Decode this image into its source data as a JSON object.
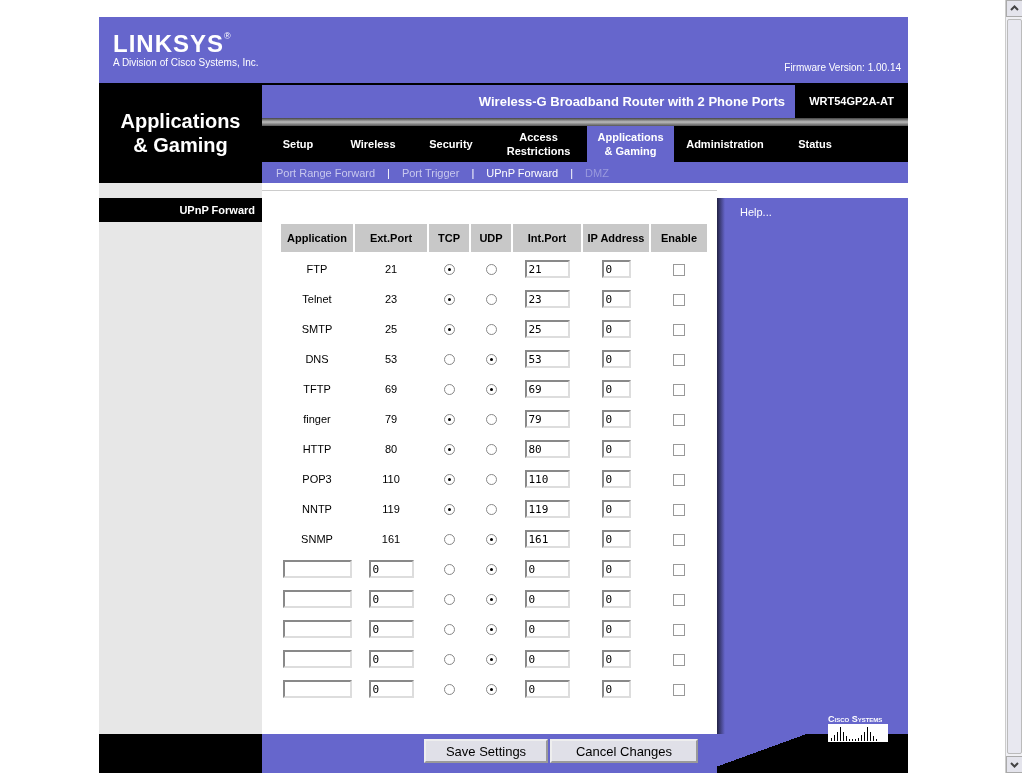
{
  "header": {
    "logo": "LINKSYS",
    "logo_mark": "®",
    "tagline": "A Division of Cisco Systems, Inc.",
    "firmware": "Firmware Version: 1.00.14"
  },
  "section_title": "Applications & Gaming",
  "product": {
    "name": "Wireless-G Broadband Router with 2 Phone Ports",
    "model": "WRT54GP2A-AT"
  },
  "tabs": [
    {
      "label": "Setup",
      "selected": false
    },
    {
      "label": "Wireless",
      "selected": false
    },
    {
      "label": "Security",
      "selected": false
    },
    {
      "label": "Access Restrictions",
      "selected": false
    },
    {
      "label": "Applications & Gaming",
      "selected": true
    },
    {
      "label": "Administration",
      "selected": false
    },
    {
      "label": "Status",
      "selected": false
    }
  ],
  "subtabs": [
    {
      "label": "Port Range Forward",
      "selected": false,
      "disabled": false
    },
    {
      "separator": "|",
      "label": "Port Trigger",
      "selected": false,
      "disabled": false
    },
    {
      "separator": "|",
      "label": "UPnP Forward",
      "selected": true,
      "disabled": false
    },
    {
      "separator": "|",
      "label": "DMZ",
      "selected": false,
      "disabled": true
    }
  ],
  "sidebar_title": "UPnP Forward",
  "help": "Help...",
  "table": {
    "columns": [
      "Application",
      "Ext.Port",
      "TCP",
      "UDP",
      "Int.Port",
      "IP Address",
      "Enable"
    ],
    "rows": [
      {
        "kind": "fixed",
        "application": "FTP",
        "ext_port": "21",
        "tcp": true,
        "udp": false,
        "int_port": "21",
        "ip": "0",
        "enabled": false
      },
      {
        "kind": "fixed",
        "application": "Telnet",
        "ext_port": "23",
        "tcp": true,
        "udp": false,
        "int_port": "23",
        "ip": "0",
        "enabled": false
      },
      {
        "kind": "fixed",
        "application": "SMTP",
        "ext_port": "25",
        "tcp": true,
        "udp": false,
        "int_port": "25",
        "ip": "0",
        "enabled": false
      },
      {
        "kind": "fixed",
        "application": "DNS",
        "ext_port": "53",
        "tcp": false,
        "udp": true,
        "int_port": "53",
        "ip": "0",
        "enabled": false
      },
      {
        "kind": "fixed",
        "application": "TFTP",
        "ext_port": "69",
        "tcp": false,
        "udp": true,
        "int_port": "69",
        "ip": "0",
        "enabled": false
      },
      {
        "kind": "fixed",
        "application": "finger",
        "ext_port": "79",
        "tcp": true,
        "udp": false,
        "int_port": "79",
        "ip": "0",
        "enabled": false
      },
      {
        "kind": "fixed",
        "application": "HTTP",
        "ext_port": "80",
        "tcp": true,
        "udp": false,
        "int_port": "80",
        "ip": "0",
        "enabled": false
      },
      {
        "kind": "fixed",
        "application": "POP3",
        "ext_port": "110",
        "tcp": true,
        "udp": false,
        "int_port": "110",
        "ip": "0",
        "enabled": false
      },
      {
        "kind": "fixed",
        "application": "NNTP",
        "ext_port": "119",
        "tcp": true,
        "udp": false,
        "int_port": "119",
        "ip": "0",
        "enabled": false
      },
      {
        "kind": "fixed",
        "application": "SNMP",
        "ext_port": "161",
        "tcp": false,
        "udp": true,
        "int_port": "161",
        "ip": "0",
        "enabled": false
      },
      {
        "kind": "custom",
        "ext_port": "0",
        "tcp": false,
        "udp": true,
        "int_port": "0",
        "ip": "0",
        "enabled": false
      },
      {
        "kind": "custom",
        "ext_port": "0",
        "tcp": false,
        "udp": true,
        "int_port": "0",
        "ip": "0",
        "enabled": false
      },
      {
        "kind": "custom",
        "ext_port": "0",
        "tcp": false,
        "udp": true,
        "int_port": "0",
        "ip": "0",
        "enabled": false
      },
      {
        "kind": "custom",
        "ext_port": "0",
        "tcp": false,
        "udp": true,
        "int_port": "0",
        "ip": "0",
        "enabled": false
      },
      {
        "kind": "custom",
        "ext_port": "0",
        "tcp": false,
        "udp": true,
        "int_port": "0",
        "ip": "0",
        "enabled": false
      }
    ]
  },
  "buttons": [
    "Save Settings",
    "Cancel Changes"
  ],
  "footer_logo": "Cisco Systems"
}
